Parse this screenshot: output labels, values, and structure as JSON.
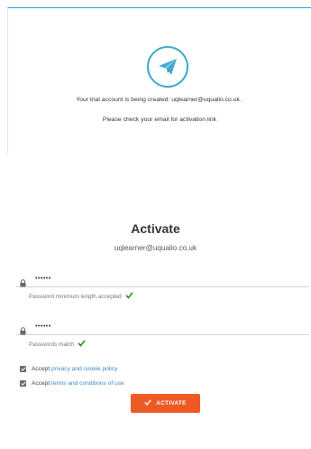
{
  "notification": {
    "line1": "Your trial account is being created: uqlearner@uqualio.co.uk .",
    "line2": "Please check your email for activation link",
    "icon": "paper-plane-icon",
    "icon_color": "#41a9cc"
  },
  "activate": {
    "title": "Activate",
    "email": "uqlearner@uqualio.co.uk",
    "password": {
      "value": "••••••",
      "hint": "Password minimum length accepted"
    },
    "confirm_password": {
      "value": "••••••",
      "hint": "Passwords match"
    },
    "privacy": {
      "prefix": "Accept",
      "link": "privacy and cookie policy",
      "checked": true
    },
    "terms": {
      "prefix": "Accept",
      "link": "terms and conditions of use",
      "checked": true
    },
    "button_label": "ACTIVATE"
  },
  "colors": {
    "accent": "#ee5a24",
    "link": "#3a86c9",
    "success": "#2e8b1f",
    "card_border": "#2a9fd6"
  }
}
